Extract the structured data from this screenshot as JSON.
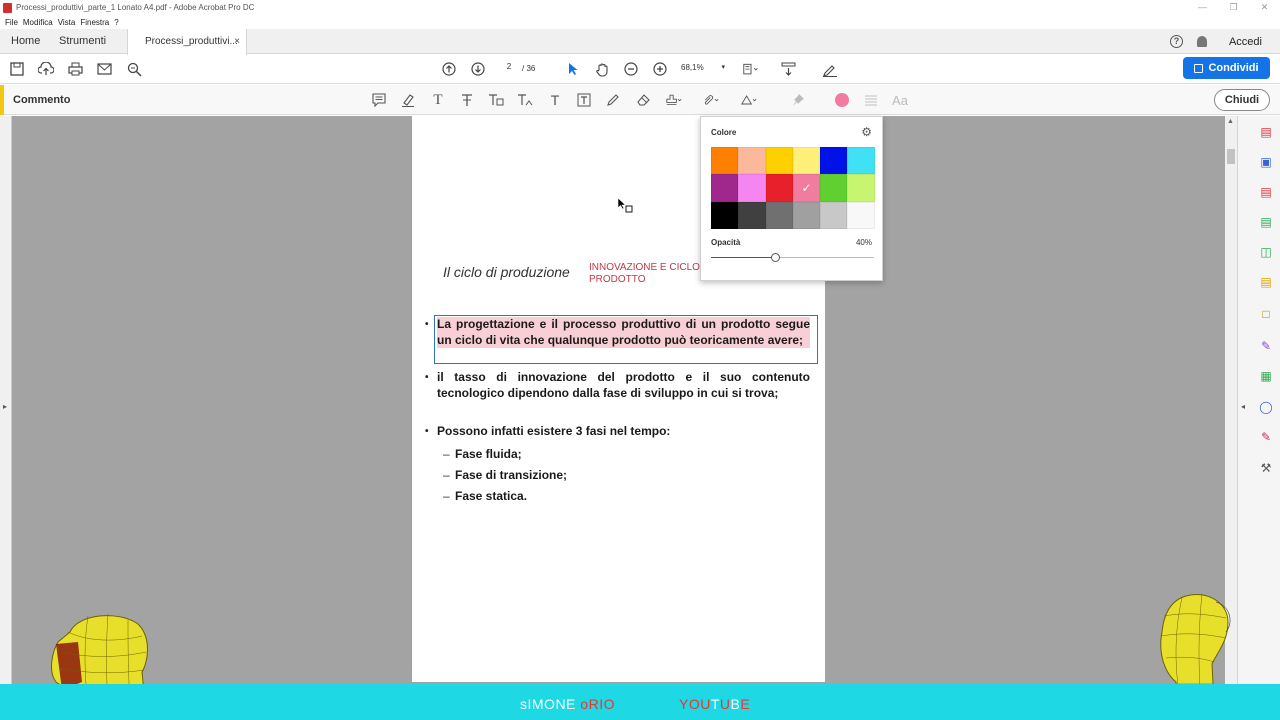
{
  "window": {
    "title": "Processi_produttivi_parte_1 Lonato A4.pdf - Adobe Acrobat Pro DC",
    "menu": [
      "File",
      "Modifica",
      "Vista",
      "Finestra",
      "?"
    ]
  },
  "tabs": {
    "home": "Home",
    "tools": "Strumenti",
    "document": "Processi_produttivi...",
    "close": "×"
  },
  "header_right": {
    "signin": "Accedi"
  },
  "toolbar": {
    "page_current": "2",
    "page_total": "/ 36",
    "zoom": "68,1%",
    "share_label": "Condividi"
  },
  "comment_bar": {
    "label": "Commento",
    "font_label": "Aa",
    "close_label": "Chiudi",
    "active_color": "#f27ba0"
  },
  "document": {
    "title": "Il ciclo di produzione",
    "subtitle_line1": "INNOVAZIONE E CICLO",
    "subtitle_line2": "PRODOTTO",
    "bullets": [
      "La progettazione e il processo produttivo di un prodotto segue un ciclo di vita che qualunque prodotto può teoricamente avere;",
      "il tasso di innovazione del prodotto e il suo contenuto tecnologico dipendono dalla fase di sviluppo in cui si trova;",
      "Possono infatti esistere 3 fasi nel tempo:"
    ],
    "sub_bullets": [
      "Fase fluida;",
      "Fase di transizione;",
      "Fase statica."
    ]
  },
  "color_popup": {
    "title": "Colore",
    "opacity_label": "Opacità",
    "opacity_value": "40%",
    "opacity_fraction": 0.4,
    "swatches": [
      "#ff7f00",
      "#fbb89a",
      "#ffd000",
      "#fff07a",
      "#0012e8",
      "#40e0f5",
      "#a0288c",
      "#f585f0",
      "#e8202c",
      "#f27ba0",
      "#60d030",
      "#c8f570",
      "#000000",
      "#404040",
      "#707070",
      "#a0a0a0",
      "#c8c8c8",
      "#f8f8f8"
    ],
    "selected_index": 9
  },
  "banner": {
    "left_text": [
      "s",
      "IMONE ",
      "o",
      "RIO"
    ],
    "right_text": [
      "YOU",
      "T",
      "U",
      "B",
      "E"
    ]
  }
}
